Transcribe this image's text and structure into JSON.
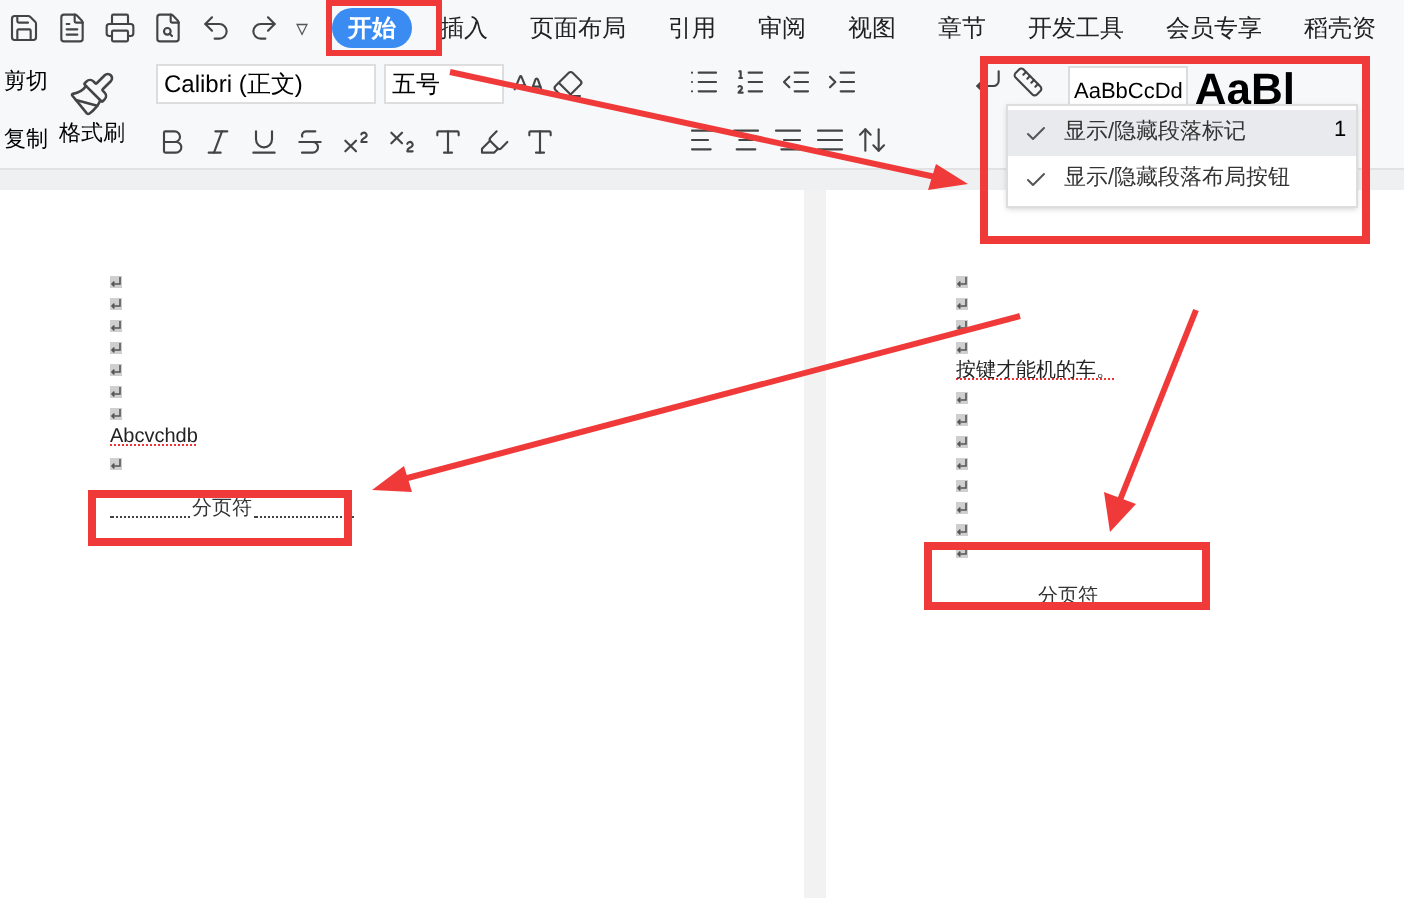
{
  "quick_access_more": "▿",
  "tabs": [
    {
      "label": "开始",
      "selected": true
    },
    {
      "label": "插入",
      "selected": false
    },
    {
      "label": "页面布局",
      "selected": false
    },
    {
      "label": "引用",
      "selected": false
    },
    {
      "label": "审阅",
      "selected": false
    },
    {
      "label": "视图",
      "selected": false
    },
    {
      "label": "章节",
      "selected": false
    },
    {
      "label": "开发工具",
      "selected": false
    },
    {
      "label": "会员专享",
      "selected": false
    },
    {
      "label": "稻壳资",
      "selected": false
    }
  ],
  "clipboard": {
    "cut": "剪切",
    "copy": "复制",
    "format_painter": "格式刷"
  },
  "font": {
    "name": "Calibri (正文)",
    "size": "五号"
  },
  "styles": [
    {
      "preview": "AaBbCcDd",
      "kind": "normal"
    },
    {
      "preview": "AaBl",
      "kind": "heading"
    }
  ],
  "style_label": "1",
  "paragraph_menu": {
    "items": [
      {
        "label": "显示/隐藏段落标记",
        "checked": true,
        "selected": true
      },
      {
        "label": "显示/隐藏段落布局按钮",
        "checked": true,
        "selected": false
      }
    ]
  },
  "pages": [
    {
      "lines": [
        {
          "kind": "mark"
        },
        {
          "kind": "mark"
        },
        {
          "kind": "mark"
        },
        {
          "kind": "mark"
        },
        {
          "kind": "mark"
        },
        {
          "kind": "mark"
        },
        {
          "kind": "mark"
        },
        {
          "kind": "text",
          "text": "Abcvchdb"
        },
        {
          "kind": "mark"
        },
        {
          "kind": "break",
          "text": "分页符"
        }
      ]
    },
    {
      "lines": [
        {
          "kind": "mark"
        },
        {
          "kind": "mark"
        },
        {
          "kind": "mark"
        },
        {
          "kind": "mark"
        },
        {
          "kind": "text",
          "text": "按键才能机的车。"
        },
        {
          "kind": "mark"
        },
        {
          "kind": "mark"
        },
        {
          "kind": "mark"
        },
        {
          "kind": "mark"
        },
        {
          "kind": "mark"
        },
        {
          "kind": "mark"
        },
        {
          "kind": "mark"
        },
        {
          "kind": "mark"
        },
        {
          "kind": "break",
          "text": "分页符"
        }
      ]
    }
  ]
}
